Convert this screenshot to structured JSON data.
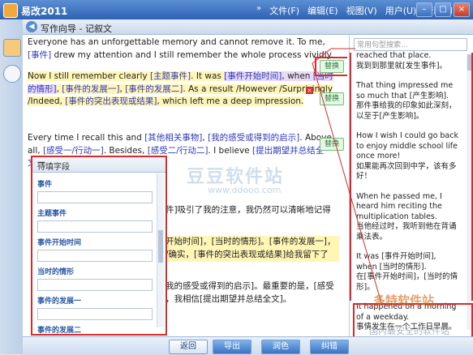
{
  "app": {
    "title": "易改2011"
  },
  "menu": [
    "文件(F)",
    "编辑(E)",
    "视图(V)",
    "用户(U)",
    "帮助(H)"
  ],
  "menu_chevron": "»",
  "window_buttons": [
    "–",
    "□",
    "×"
  ],
  "inner": {
    "title": "写作向导 - 记叙文"
  },
  "editor": {
    "p1a": "Everyone has an unforgettable memory and cannot remove it. To me, ",
    "p1_ph": "[事件]",
    "p1b": " drew my attention and I still remember the whole process vividly.",
    "p2a": "Now I still remember clearly ",
    "p2_ph1": "[主题事件]",
    "p2b": ". It was ",
    "p2_ph2": "[事件开始时间]",
    "p2c": ", when ",
    "p2_ph3": "[当时的情形]",
    "p2d": ", ",
    "p2_ph4": "[事件的发展一]",
    "p2e": ", ",
    "p2_ph5": "[事件的发展二]",
    "p2f": ". As a result /However /Surprisingly /Indeed, ",
    "p2_ph6": "[事件的突出表现或结果]",
    "p2g": ", which left me a deep impression.",
    "p3a": "Every time I recall this and ",
    "p3_ph1": "[其他相关事物]",
    "p3b": ", ",
    "p3_ph2": "[我的感受或得到的启示]",
    "p3c": ". Above all, ",
    "p3_ph3": "[感受一/行动一]",
    "p3d": ". Besides, ",
    "p3_ph4": "[感受二/行动二]",
    "p3e": ". I believe ",
    "p3_ph5": "[提出期望并总结全文]",
    "p3f": ".",
    "cn1": "件]吸引了我的注意，我仍然可以清晰地记得",
    "cn2": "开始时间]，[当时的情形]。[事件的发展一]，",
    "cn3": "/确实，[事件的突出表现或结果]给我留下了",
    "cn4": "我的感受或得到的启示]。最重要的是，[感受",
    "cn5": "，我相信[提出期望并总结全文]。",
    "replace_label": "替换"
  },
  "panel": {
    "title": "待填字段",
    "minimize": "—",
    "fields": [
      "事件",
      "主题事件",
      "事件开始时间",
      "当时的情形",
      "事件的发展一",
      "事件的发展二"
    ]
  },
  "sidebar": {
    "search_placeholder": "常用句型搜索...",
    "tips": [
      {
        "en": "reached that place.",
        "cn": "我到到那里就[发生事件]。"
      },
      {
        "en": "That thing impressed me so much that [产生影响].",
        "cn": "那件事给我的印象如此深刻，以至于[产生影响]。"
      },
      {
        "en": "How I wish I could go back to enjoy middle school life once more!",
        "cn": "如果能再次回到中学，该有多好！"
      },
      {
        "en": "When he passed me, I heard him reciting the multiplication tables.",
        "cn": "当他经过时，我听到他在背诵乘法表。"
      },
      {
        "en": "It was [事件开始时间], when [当时的情形].",
        "cn": "在[事件开始时间]，[当时的情形]。"
      },
      {
        "en": "It happened on a morning of a weekday.",
        "cn": "事情发生在一个工作日早晨。"
      }
    ]
  },
  "bottom": {
    "back": "返回",
    "export": "导出",
    "polish": "润色",
    "correct": "纠错"
  },
  "watermark": {
    "main": "豆豆软件站",
    "url": "www.ddooo.com",
    "site": "国内最安全的软件站",
    "brand": "多特软件站"
  }
}
